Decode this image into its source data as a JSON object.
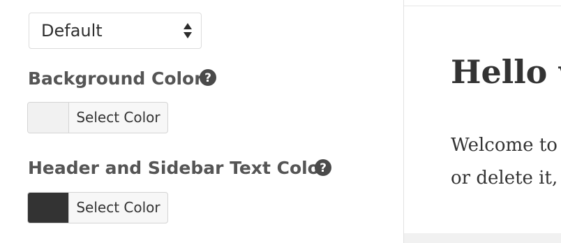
{
  "layout_select": {
    "value": "Default"
  },
  "background_color": {
    "label": "Background Color",
    "button_label": "Select Color",
    "swatch_color": "#f1f1f1"
  },
  "header_sidebar_text_color": {
    "label": "Header and Sidebar Text Color",
    "button_label": "Select Color",
    "swatch_color": "#333333"
  },
  "help_icon_color": "#4a4a4a",
  "preview": {
    "title": "Hello w",
    "paragraph_lines": [
      "Welcome to",
      "or delete it,"
    ]
  }
}
